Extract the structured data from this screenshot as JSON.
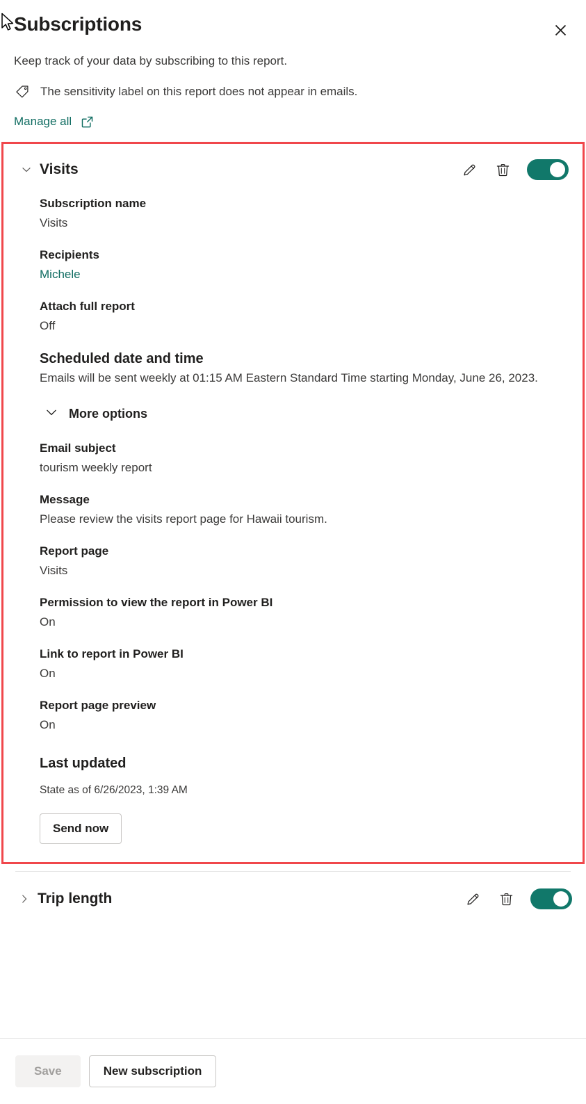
{
  "header": {
    "title": "Subscriptions",
    "close_label": "×",
    "intro": "Keep track of your data by subscribing to this report.",
    "sensitivity_notice": "The sensitivity label on this report does not appear in emails.",
    "manage_all_label": "Manage all"
  },
  "colors": {
    "accent_teal": "#11786a",
    "link_teal": "#0f6c61",
    "highlight_red": "#f0474b",
    "disabled_text": "#a19f9d"
  },
  "subscriptions": [
    {
      "name": "Visits",
      "expanded": true,
      "toggle_state": "On",
      "fields": [
        {
          "label": "Subscription name",
          "value": "Visits",
          "style": "normal"
        },
        {
          "label": "Recipients",
          "value": "Michele",
          "style": "teal"
        },
        {
          "label": "Attach full report",
          "value": "Off",
          "style": "normal"
        }
      ],
      "schedule": {
        "heading": "Scheduled date and time",
        "value": "Emails will be sent weekly at 01:15 AM Eastern Standard Time starting Monday, June 26, 2023."
      },
      "more_options_label": "More options",
      "more_options_fields": [
        {
          "label": "Email subject",
          "value": "tourism weekly report"
        },
        {
          "label": "Message",
          "value": "Please review the visits report page for Hawaii tourism."
        },
        {
          "label": "Report page",
          "value": "Visits"
        },
        {
          "label": "Permission to view the report in Power BI",
          "value": "On"
        },
        {
          "label": "Link to report in Power BI",
          "value": "On"
        },
        {
          "label": "Report page preview",
          "value": "On"
        }
      ],
      "last_updated": {
        "heading": "Last updated",
        "value": "State as of 6/26/2023, 1:39 AM"
      },
      "send_now_label": "Send now"
    },
    {
      "name": "Trip length",
      "expanded": false,
      "toggle_state": "On"
    }
  ],
  "footer": {
    "save_label": "Save",
    "save_disabled": true,
    "new_subscription_label": "New subscription"
  }
}
